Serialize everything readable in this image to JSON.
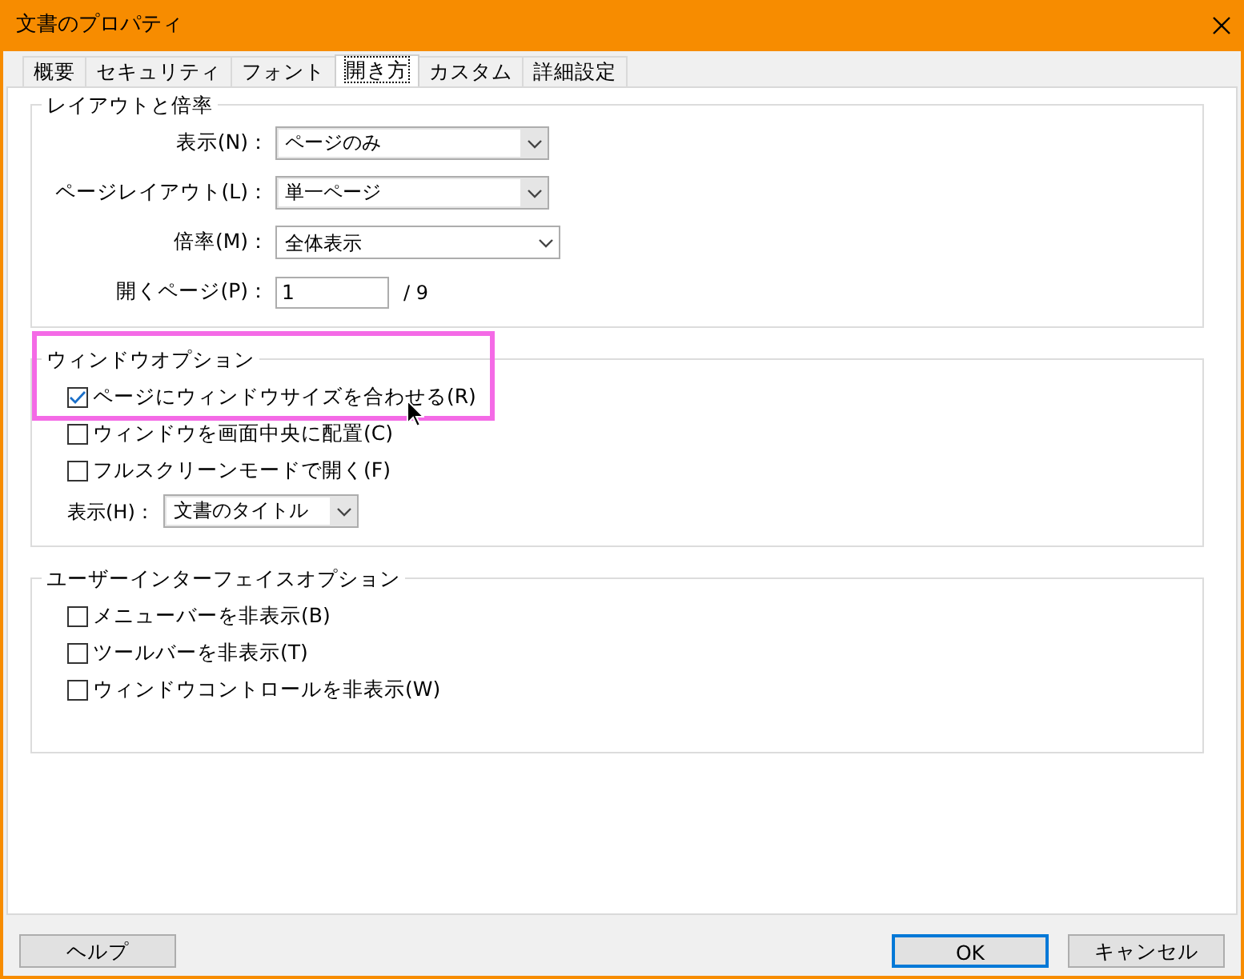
{
  "window": {
    "title": "文書のプロパティ"
  },
  "tabs": [
    {
      "label": "概要",
      "selected": false
    },
    {
      "label": "セキュリティ",
      "selected": false
    },
    {
      "label": "フォント",
      "selected": false
    },
    {
      "label": "開き方",
      "selected": true
    },
    {
      "label": "カスタム",
      "selected": false
    },
    {
      "label": "詳細設定",
      "selected": false
    }
  ],
  "layout_group": {
    "title": "レイアウトと倍率",
    "fields": [
      {
        "label": "表示(N)：",
        "kind": "combo",
        "value": "ページのみ"
      },
      {
        "label": "ページレイアウト(L)：",
        "kind": "combo",
        "value": "単一ページ"
      },
      {
        "label": "倍率(M)：",
        "kind": "dropdown",
        "value": "全体表示"
      },
      {
        "label": "開くページ(P)：",
        "kind": "text",
        "value": "1",
        "suffix": "/ 9"
      }
    ]
  },
  "window_group": {
    "title": "ウィンドウオプション",
    "checkboxes": [
      {
        "label": "ページにウィンドウサイズを合わせる(R)",
        "checked": true
      },
      {
        "label": "ウィンドウを画面中央に配置(C)",
        "checked": false
      },
      {
        "label": "フルスクリーンモードで開く(F)",
        "checked": false
      }
    ],
    "show": {
      "label": "表示(H)：",
      "value": "文書のタイトル"
    }
  },
  "ui_group": {
    "title": "ユーザーインターフェイスオプション",
    "checkboxes": [
      {
        "label": "メニューバーを非表示(B)",
        "checked": false
      },
      {
        "label": "ツールバーを非表示(T)",
        "checked": false
      },
      {
        "label": "ウィンドウコントロールを非表示(W)",
        "checked": false
      }
    ]
  },
  "buttons": {
    "help": "ヘルプ",
    "ok": "OK",
    "cancel": "キャンセル"
  }
}
